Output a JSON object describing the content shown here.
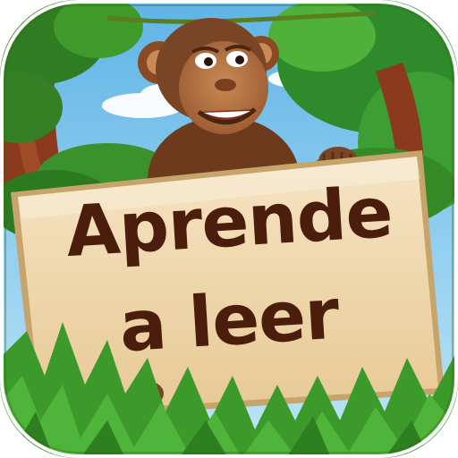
{
  "sign": {
    "line1": "Aprende",
    "line2": "a leer"
  },
  "icons": {
    "character": "monkey-mascot-icon"
  },
  "colors": {
    "sky": "#7cc6ec",
    "jungle_green": "#3f9a2a",
    "sign_board": "#f1dbb3",
    "sign_text": "#4a1d0c",
    "monkey_fur": "#7a4524"
  }
}
